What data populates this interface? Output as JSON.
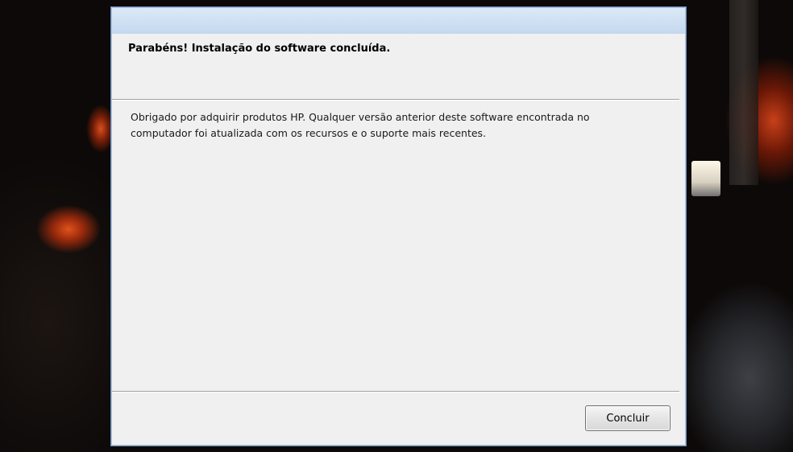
{
  "dialog": {
    "heading": "Parabéns! Instalação do software concluída.",
    "message_lines": [
      "Obrigado por adquirir produtos HP. Qualquer versão anterior deste software encontrada no",
      "computador foi atualizada com os recursos e o suporte mais recentes."
    ],
    "finish_label": "Concluir"
  },
  "colors": {
    "dialog_bg": "#f0f0f0",
    "titlebar": "#c4d8ef",
    "border": "#6f8fb5"
  }
}
